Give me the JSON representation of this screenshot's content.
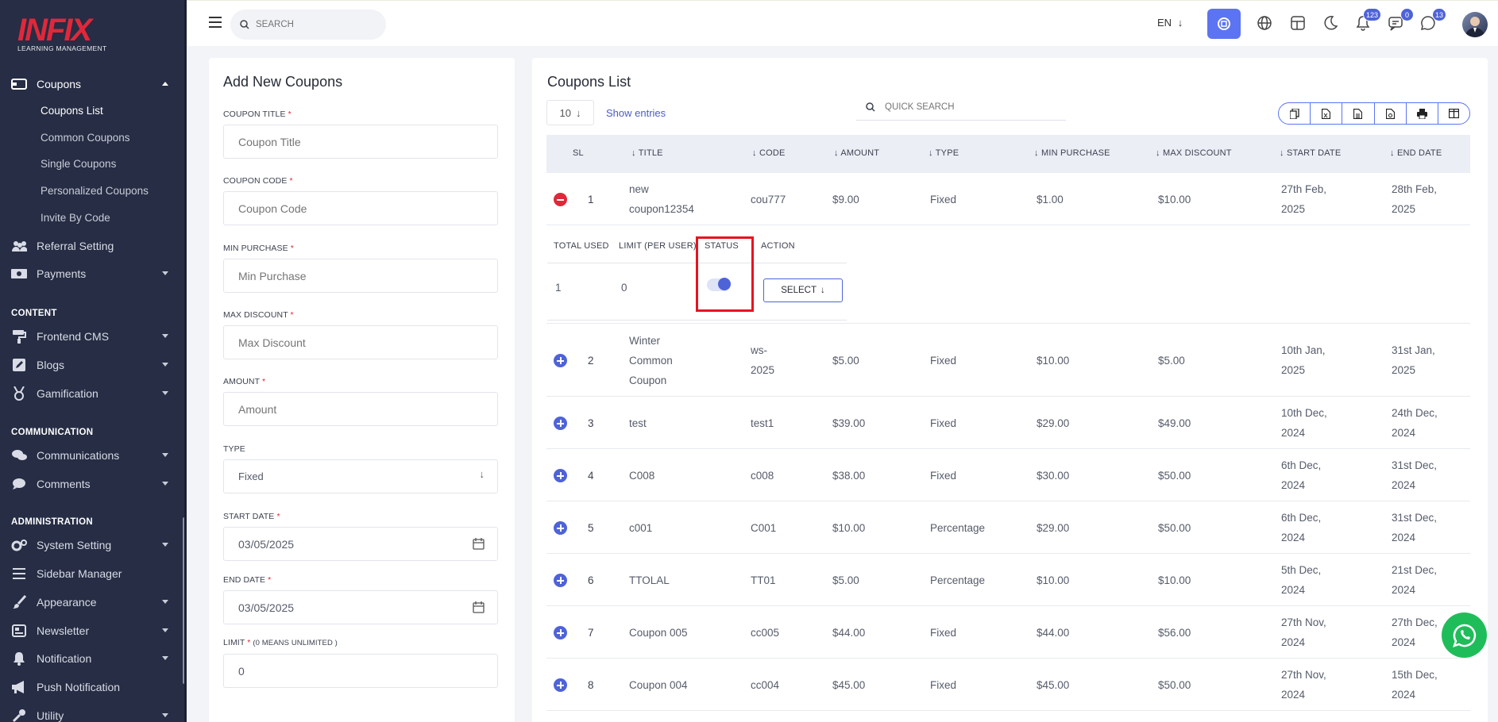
{
  "logo": {
    "brand": "INFIX",
    "subtitle": "LEARNING MANAGEMENT"
  },
  "sidebar": {
    "coupons": "Coupons",
    "coupons_sub": [
      "Coupons List",
      "Common Coupons",
      "Single Coupons",
      "Personalized Coupons",
      "Invite By Code"
    ],
    "referral": "Referral Setting",
    "payments": "Payments",
    "sec_content": "CONTENT",
    "frontend_cms": "Frontend CMS",
    "blogs": "Blogs",
    "gamification": "Gamification",
    "sec_communication": "COMMUNICATION",
    "communications": "Communications",
    "comments": "Comments",
    "sec_administration": "ADMINISTRATION",
    "system_setting": "System Setting",
    "sidebar_manager": "Sidebar Manager",
    "appearance": "Appearance",
    "newsletter": "Newsletter",
    "notification": "Notification",
    "push_notification": "Push Notification",
    "utility": "Utility"
  },
  "topbar": {
    "search_placeholder": "SEARCH",
    "lang": "EN",
    "badges": {
      "notifications": "123",
      "messages": "0",
      "chat": "13"
    }
  },
  "form": {
    "title": "Add New Coupons",
    "coupon_title_label": "COUPON TITLE",
    "coupon_title_placeholder": "Coupon Title",
    "coupon_code_label": "COUPON CODE",
    "coupon_code_placeholder": "Coupon Code",
    "min_purchase_label": "MIN PURCHASE",
    "min_purchase_placeholder": "Min Purchase",
    "max_discount_label": "MAX DISCOUNT",
    "max_discount_placeholder": "Max Discount",
    "amount_label": "AMOUNT",
    "amount_placeholder": "Amount",
    "type_label": "TYPE",
    "type_value": "Fixed",
    "start_date_label": "START DATE",
    "start_date_value": "03/05/2025",
    "end_date_label": "END DATE",
    "end_date_value": "03/05/2025",
    "limit_label": "LIMIT",
    "limit_hint": "(0 MEANS UNLIMITED )",
    "limit_value": "0",
    "required_mark": "*"
  },
  "list": {
    "title": "Coupons List",
    "entries_value": "10",
    "show_entries": "Show entries",
    "quick_search": "QUICK SEARCH",
    "columns": [
      "SL",
      "TITLE",
      "CODE",
      "AMOUNT",
      "TYPE",
      "MIN PURCHASE",
      "MAX DISCOUNT",
      "START DATE",
      "END DATE"
    ],
    "detail_columns": [
      "TOTAL USED",
      "LIMIT (PER USER)",
      "STATUS",
      "ACTION"
    ],
    "detail_values": {
      "total_used": "1",
      "limit_per_user": "0",
      "status_on": true,
      "action": "SELECT"
    },
    "rows": [
      {
        "sl": "1",
        "title": [
          "new",
          "coupon12354"
        ],
        "code": [
          "cou777"
        ],
        "amount": "$9.00",
        "type": "Fixed",
        "min": "$1.00",
        "max": "$10.00",
        "start": [
          "27th Feb,",
          "2025"
        ],
        "end": [
          "28th Feb,",
          "2025"
        ]
      },
      {
        "sl": "2",
        "title": [
          "Winter",
          "Common",
          "Coupon"
        ],
        "code": [
          "ws-",
          "2025"
        ],
        "amount": "$5.00",
        "type": "Fixed",
        "min": "$10.00",
        "max": "$5.00",
        "start": [
          "10th Jan,",
          "2025"
        ],
        "end": [
          "31st Jan,",
          "2025"
        ]
      },
      {
        "sl": "3",
        "title": [
          "test"
        ],
        "code": [
          "test1"
        ],
        "amount": "$39.00",
        "type": "Fixed",
        "min": "$29.00",
        "max": "$49.00",
        "start": [
          "10th Dec,",
          "2024"
        ],
        "end": [
          "24th Dec,",
          "2024"
        ]
      },
      {
        "sl": "4",
        "title": [
          "C008"
        ],
        "code": [
          "c008"
        ],
        "amount": "$38.00",
        "type": "Fixed",
        "min": "$30.00",
        "max": "$50.00",
        "start": [
          "6th Dec,",
          "2024"
        ],
        "end": [
          "31st Dec,",
          "2024"
        ]
      },
      {
        "sl": "5",
        "title": [
          "c001"
        ],
        "code": [
          "C001"
        ],
        "amount": "$10.00",
        "type": "Percentage",
        "min": "$29.00",
        "max": "$50.00",
        "start": [
          "6th Dec,",
          "2024"
        ],
        "end": [
          "31st Dec,",
          "2024"
        ]
      },
      {
        "sl": "6",
        "title": [
          "TTOLAL"
        ],
        "code": [
          "TT01"
        ],
        "amount": "$5.00",
        "type": "Percentage",
        "min": "$10.00",
        "max": "$10.00",
        "start": [
          "5th Dec,",
          "2024"
        ],
        "end": [
          "21st Dec,",
          "2024"
        ]
      },
      {
        "sl": "7",
        "title": [
          "Coupon 005"
        ],
        "code": [
          "cc005"
        ],
        "amount": "$44.00",
        "type": "Fixed",
        "min": "$44.00",
        "max": "$56.00",
        "start": [
          "27th Nov,",
          "2024"
        ],
        "end": [
          "27th Dec,",
          "2024"
        ]
      },
      {
        "sl": "8",
        "title": [
          "Coupon 004"
        ],
        "code": [
          "cc004"
        ],
        "amount": "$45.00",
        "type": "Fixed",
        "min": "$45.00",
        "max": "$50.00",
        "start": [
          "27th Nov,",
          "2024"
        ],
        "end": [
          "15th Dec,",
          "2024"
        ]
      }
    ]
  },
  "colors": {
    "accent": "#5c74f2",
    "sidebar_bg": "#262d44",
    "danger": "#e0283a",
    "whatsapp": "#1fbd5a"
  }
}
